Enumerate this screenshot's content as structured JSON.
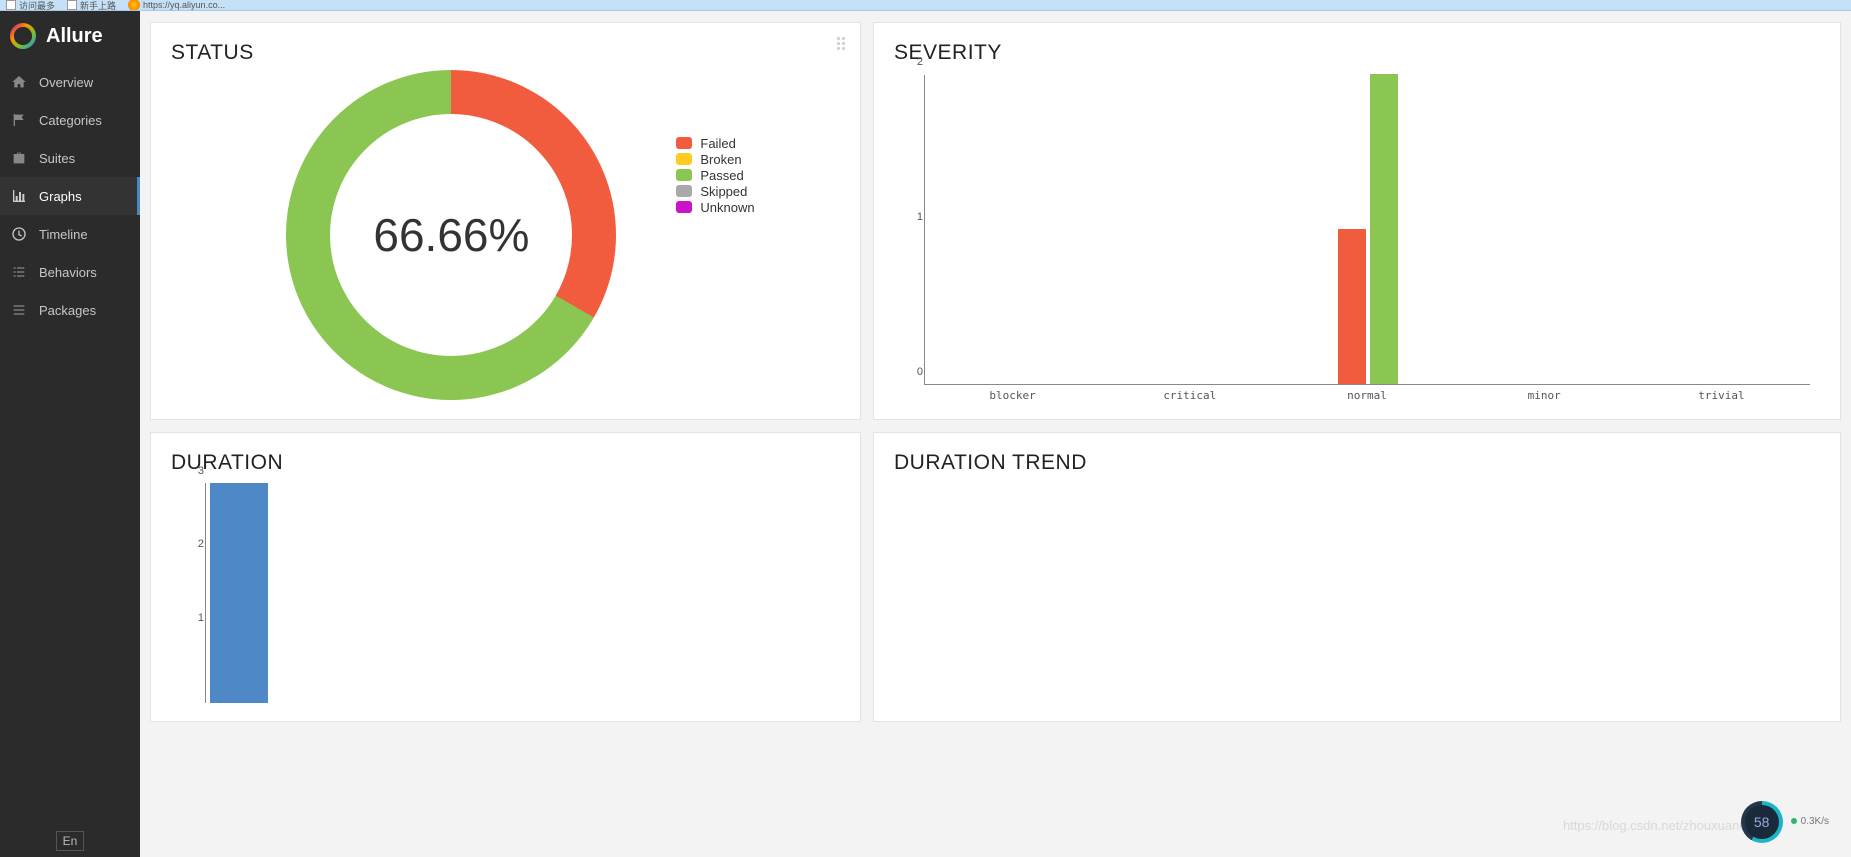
{
  "browser": {
    "bookmark1": "访问最多",
    "bookmark2": "新手上路",
    "url": "https://yq.aliyun.co..."
  },
  "brand": {
    "name": "Allure"
  },
  "nav": {
    "items": [
      {
        "label": "Overview",
        "icon": "home-icon"
      },
      {
        "label": "Categories",
        "icon": "flag-icon"
      },
      {
        "label": "Suites",
        "icon": "briefcase-icon"
      },
      {
        "label": "Graphs",
        "icon": "chart-icon"
      },
      {
        "label": "Timeline",
        "icon": "clock-icon"
      },
      {
        "label": "Behaviors",
        "icon": "list-icon"
      },
      {
        "label": "Packages",
        "icon": "list2-icon"
      }
    ],
    "lang": "En",
    "active_index": 3
  },
  "cards": {
    "status": {
      "title": "STATUS",
      "center_label": "66.66%",
      "legend": {
        "failed": "Failed",
        "broken": "Broken",
        "passed": "Passed",
        "skipped": "Skipped",
        "unknown": "Unknown"
      }
    },
    "severity": {
      "title": "SEVERITY"
    },
    "duration": {
      "title": "DURATION"
    },
    "trend": {
      "title": "DURATION TREND"
    }
  },
  "indicator": {
    "value": "58",
    "net": "0.3K/s",
    "watermark": "https://blog.csdn.net/zhouxuan623"
  },
  "chart_data": [
    {
      "type": "pie",
      "title": "STATUS",
      "series": [
        {
          "name": "Failed",
          "value": 1,
          "angle_deg": 120,
          "color": "#f15b3e"
        },
        {
          "name": "Broken",
          "value": 0,
          "angle_deg": 0,
          "color": "#ffcb21"
        },
        {
          "name": "Passed",
          "value": 2,
          "angle_deg": 240,
          "color": "#8ac651"
        },
        {
          "name": "Skipped",
          "value": 0,
          "angle_deg": 0,
          "color": "#a9a9a9"
        },
        {
          "name": "Unknown",
          "value": 0,
          "angle_deg": 0,
          "color": "#c913c9"
        }
      ],
      "center_label": "66.66%"
    },
    {
      "type": "bar",
      "title": "SEVERITY",
      "categories": [
        "blocker",
        "critical",
        "normal",
        "minor",
        "trivial"
      ],
      "series": [
        {
          "name": "Failed",
          "color": "#f15b3e",
          "values": [
            0,
            0,
            1,
            0,
            0
          ]
        },
        {
          "name": "Passed",
          "color": "#8ac651",
          "values": [
            0,
            0,
            2,
            0,
            0
          ]
        }
      ],
      "ylim": [
        0,
        2
      ],
      "yticks": [
        0,
        1,
        2
      ]
    },
    {
      "type": "bar",
      "title": "DURATION",
      "categories": [
        ""
      ],
      "values": [
        3
      ],
      "color": "#4e88c7",
      "ylim": [
        0,
        3
      ],
      "yticks": [
        1,
        2,
        3
      ]
    }
  ]
}
